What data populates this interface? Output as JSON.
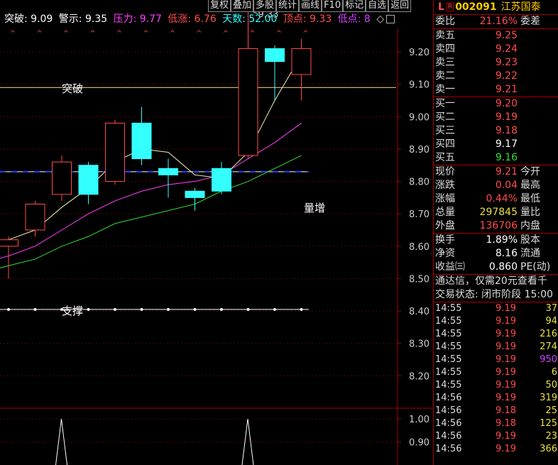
{
  "toolbar": [
    "复权",
    "叠加",
    "多股",
    "统计",
    "画线",
    "F10",
    "标记",
    "自选",
    "返回"
  ],
  "indicator": {
    "breakout_label": "突破: 9.09",
    "warn_label": "警示: 9.35",
    "pressure_label": "压力: 9.77",
    "lowrise_label": "低涨: 6.76",
    "days_label": "天数: 52.00",
    "top_label": "顶点: 9.33",
    "bottom_label": "低点: 8",
    "colors": {
      "white": "#ffffff",
      "pressure": "#ff40ff",
      "lowrise": "#ff4d4d",
      "days": "#33ffff",
      "top": "#ff4d4d",
      "bottom": "#d040ff"
    }
  },
  "annotations": {
    "breakout": "突破",
    "support": "支撑",
    "volume_up": "量增",
    "peak": "9.33"
  },
  "chart_data": [
    {
      "type": "candlestick",
      "y_ticks": [
        9.2,
        9.1,
        9.0,
        8.9,
        8.8,
        8.7,
        8.6,
        8.5,
        8.4,
        8.3,
        8.2
      ],
      "ylim": [
        8.1,
        9.36
      ],
      "candles": [
        {
          "open": 8.6,
          "close": 8.62,
          "high": 8.63,
          "low": 8.5
        },
        {
          "open": 8.65,
          "close": 8.73,
          "high": 8.74,
          "low": 8.63
        },
        {
          "open": 8.76,
          "close": 8.86,
          "high": 8.88,
          "low": 8.74
        },
        {
          "open": 8.85,
          "close": 8.76,
          "high": 8.86,
          "low": 8.73
        },
        {
          "open": 8.8,
          "close": 8.98,
          "high": 8.99,
          "low": 8.79
        },
        {
          "open": 8.98,
          "close": 8.87,
          "high": 9.03,
          "low": 8.85
        },
        {
          "open": 8.84,
          "close": 8.82,
          "high": 8.87,
          "low": 8.75
        },
        {
          "open": 8.77,
          "close": 8.75,
          "high": 8.78,
          "low": 8.71
        },
        {
          "open": 8.84,
          "close": 8.77,
          "high": 8.86,
          "low": 8.76
        },
        {
          "open": 8.88,
          "close": 9.21,
          "high": 9.33,
          "low": 8.87
        },
        {
          "open": 9.21,
          "close": 9.17,
          "high": 9.22,
          "low": 9.05
        },
        {
          "open": 9.13,
          "close": 9.21,
          "high": 9.24,
          "low": 9.05
        }
      ],
      "ma_white": [
        8.62,
        8.65,
        8.72,
        8.78,
        8.86,
        8.9,
        8.89,
        8.82,
        8.81,
        8.89,
        9.05,
        9.19
      ],
      "ma_magenta": [
        8.57,
        8.6,
        8.65,
        8.7,
        8.74,
        8.77,
        8.79,
        8.8,
        8.82,
        8.87,
        8.92,
        8.98
      ],
      "ma_green": [
        8.54,
        8.56,
        8.6,
        8.63,
        8.67,
        8.69,
        8.71,
        8.73,
        8.77,
        8.8,
        8.84,
        8.88
      ],
      "breakout_line": 9.09,
      "support_line": 8.405,
      "dashed_level": 8.83
    },
    {
      "type": "line",
      "y_ticks": [
        1.0,
        0.9
      ],
      "ylim": [
        0.8,
        1.04
      ],
      "values": [
        0,
        1,
        0,
        0,
        0,
        0,
        0,
        0,
        1,
        0,
        0,
        0
      ]
    }
  ],
  "panel": {
    "market_badge": "L",
    "r_badge": "R",
    "code": "002091",
    "name": "江苏国泰",
    "weibi": {
      "label": "委比",
      "value": "21.16%",
      "label2": "委差"
    },
    "asks": [
      {
        "label": "卖五",
        "price": "9.25"
      },
      {
        "label": "卖四",
        "price": "9.24"
      },
      {
        "label": "卖三",
        "price": "9.23"
      },
      {
        "label": "卖二",
        "price": "9.22"
      },
      {
        "label": "卖一",
        "price": "9.21"
      }
    ],
    "bids": [
      {
        "label": "买一",
        "price": "9.20",
        "color": "red"
      },
      {
        "label": "买二",
        "price": "9.19",
        "color": "red"
      },
      {
        "label": "买三",
        "price": "9.18",
        "color": "red"
      },
      {
        "label": "买四",
        "price": "9.17",
        "color": "white"
      },
      {
        "label": "买五",
        "price": "9.16",
        "color": "green"
      }
    ],
    "stats": [
      {
        "l1": "现价",
        "v": "9.21",
        "l2": "今开",
        "color": "red"
      },
      {
        "l1": "涨跌",
        "v": "0.04",
        "l2": "最高",
        "color": "red"
      },
      {
        "l1": "涨幅",
        "v": "0.44%",
        "l2": "最低",
        "color": "red"
      },
      {
        "l1": "总量",
        "v": "297845",
        "l2": "量比",
        "color": "yellow"
      },
      {
        "l1": "外盘",
        "v": "136706",
        "l2": "内盘",
        "color": "red"
      }
    ],
    "fund": [
      {
        "l1": "换手",
        "v": "1.89%",
        "l2": "股本"
      },
      {
        "l1": "净资",
        "v": "8.16",
        "l2": "流通"
      },
      {
        "l1": "收益㈢",
        "v": "0.860",
        "l2": "PE(动)"
      }
    ],
    "notice": "通达信，仅需20元查看千",
    "status": "交易状态: 闭市阶段 15:00",
    "ticks": [
      {
        "time": "14:55",
        "price": "9.19",
        "vol": "37",
        "c": ""
      },
      {
        "time": "14:55",
        "price": "9.19",
        "vol": "94",
        "c": ""
      },
      {
        "time": "14:55",
        "price": "9.19",
        "vol": "216",
        "c": ""
      },
      {
        "time": "14:55",
        "price": "9.19",
        "vol": "274",
        "c": ""
      },
      {
        "time": "14:55",
        "price": "9.19",
        "vol": "950",
        "c": "purple"
      },
      {
        "time": "14:55",
        "price": "9.19",
        "vol": "6",
        "c": ""
      },
      {
        "time": "14:55",
        "price": "9.19",
        "vol": "50",
        "c": ""
      },
      {
        "time": "14:56",
        "price": "9.19",
        "vol": "319",
        "c": ""
      },
      {
        "time": "14:56",
        "price": "9.18",
        "vol": "25",
        "c": ""
      },
      {
        "time": "14:56",
        "price": "9.18",
        "vol": "125",
        "c": ""
      },
      {
        "time": "14:56",
        "price": "9.19",
        "vol": "23",
        "c": ""
      },
      {
        "time": "14:56",
        "price": "9.19",
        "vol": "366",
        "c": ""
      }
    ]
  }
}
